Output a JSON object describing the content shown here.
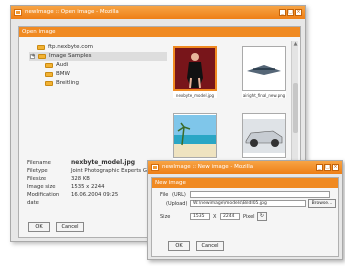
{
  "main_window": {
    "title": "newImage :: Open image - Mozilla",
    "dialog_title": "Open image"
  },
  "tree": [
    {
      "label": "ftp.nexbyte.com",
      "level": 1,
      "expand": "",
      "selected": false
    },
    {
      "label": "Image Samples",
      "level": 1,
      "expand": "+",
      "selected": true
    },
    {
      "label": "Audi",
      "level": 2,
      "expand": "",
      "selected": false
    },
    {
      "label": "BMW",
      "level": 2,
      "expand": "",
      "selected": false
    },
    {
      "label": "Breitling",
      "level": 2,
      "expand": "",
      "selected": false
    }
  ],
  "thumbnails": [
    {
      "name": "nexbyte_model.jpg"
    },
    {
      "name": "airight_final_new.png"
    },
    {
      "name": "new_beach.png"
    },
    {
      "name": "BMW_M5_CSL.jpg"
    }
  ],
  "info": {
    "filename_label": "Filename",
    "filename": "nexbyte_model.jpg",
    "filetype_label": "Filetype",
    "filetype": "Joint Photographic Experts Group",
    "filesize_label": "Filesize",
    "filesize": "328 KB",
    "size_label": "Image size",
    "size": "1535 x 2244",
    "modified_label": "Modification date",
    "modified": "16.06.2004 09:25"
  },
  "main_buttons": {
    "ok": "OK",
    "cancel": "Cancel"
  },
  "new_window": {
    "title": "newImage :: New image - Mozilla",
    "dialog_title": "New image",
    "file_label": "File",
    "url_label": "(URL)",
    "upload_label": "(Upload)",
    "upload_value": "W:\\newimage\\models\\BildI05.jpg",
    "browse": "Browse...",
    "size_label": "Size",
    "width": "1535",
    "x": "X",
    "height": "2244",
    "unit": "Pixel",
    "ok": "OK",
    "cancel": "Cancel"
  },
  "colors": {
    "accent": "#f08a22",
    "title_bg": "#ee7f16"
  }
}
